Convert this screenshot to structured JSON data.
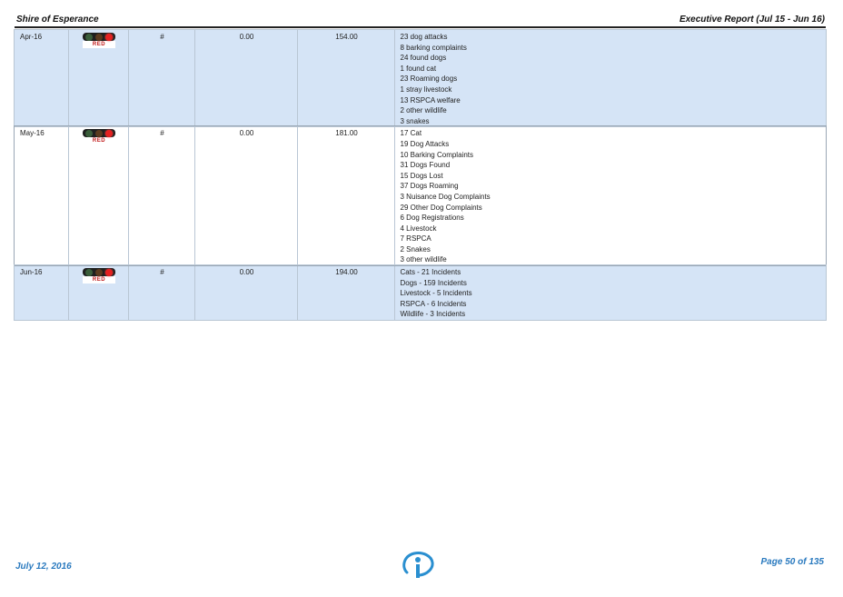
{
  "header": {
    "org": "Shire of Esperance",
    "report": "Executive Report (Jul 15 - Jun 16)"
  },
  "rows": [
    {
      "month": "Apr-16",
      "status": "RED",
      "symbol": "#",
      "target": "0.00",
      "actual": "154.00",
      "details": [
        "23 dog attacks",
        "8 barking complaints",
        "24 found dogs",
        "1 found cat",
        "23 Roaming dogs",
        "1 stray livestock",
        "13 RSPCA welfare",
        "2 other wildlife",
        "3 snakes"
      ]
    },
    {
      "month": "May-16",
      "status": "RED",
      "symbol": "#",
      "target": "0.00",
      "actual": "181.00",
      "details": [
        "17 Cat",
        "19 Dog Attacks",
        "10 Barking Complaints",
        "31 Dogs Found",
        "15 Dogs Lost",
        "37 Dogs Roaming",
        "3 Nuisance Dog Complaints",
        "29 Other Dog Complaints",
        "6 Dog Registrations",
        "4 Livestock",
        "7 RSPCA",
        "2 Snakes",
        "3 other wildlife"
      ]
    },
    {
      "month": "Jun-16",
      "status": "RED",
      "symbol": "#",
      "target": "0.00",
      "actual": "194.00",
      "details": [
        "Cats - 21 Incidents",
        "Dogs - 159  Incidents",
        "Livestock - 5 Incidents",
        "RSPCA - 6 Incidents",
        "Wildlife - 3 Incidents"
      ]
    }
  ],
  "footer": {
    "date": "July 12, 2016",
    "page": "Page 50 of 135",
    "logo_icon": "info-logo-icon"
  },
  "colors": {
    "row_band": "#d5e4f6",
    "status_red": "#e52121",
    "footer_text": "#2a7abf"
  }
}
